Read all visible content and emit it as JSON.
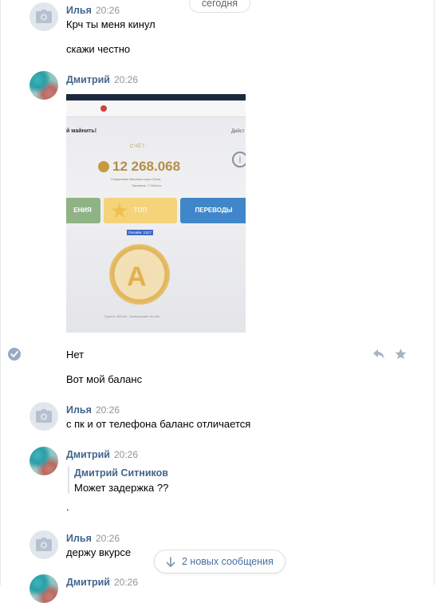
{
  "date_separator": "сегодня",
  "messages": [
    {
      "author": "Илья",
      "time": "20:26",
      "avatar": "camera-placeholder-icon",
      "lines": [
        "Крч ты меня кинул",
        "скажи честно"
      ]
    },
    {
      "author": "Дмитрий",
      "time": "20:26",
      "avatar": "photo",
      "attachment": {
        "kind": "photo",
        "screen_title": "й майнить!",
        "screen_action": "Дейст",
        "score_label": "СЧЁТ:",
        "score_value": "12 268.068",
        "sub1": "Сохранение баланса через 22сек.",
        "sub2": "Пассивно: 7.164/сек",
        "button_1": "ЕНИЯ",
        "button_2": "ТОП",
        "button_3": "ПЕРЕВОДЫ",
        "online": "Онлайн: 1317",
        "coin_letter": "A",
        "footer": "Группа: 4ВCoin · somtopvnabe.vk.com"
      },
      "lines": [
        "Нет",
        "Вот мой баланс"
      ],
      "read_icon": "check-circle-icon",
      "actions": [
        "reply-icon",
        "star-icon"
      ]
    },
    {
      "author": "Илья",
      "time": "20:26",
      "avatar": "camera-placeholder-icon",
      "lines": [
        "с пк и от телефона баланс отличается"
      ]
    },
    {
      "author": "Дмитрий",
      "time": "20:26",
      "avatar": "photo",
      "quote": {
        "author": "Дмитрий Ситников",
        "text": "Может задержка ??"
      },
      "lines": [
        "."
      ]
    },
    {
      "author": "Илья",
      "time": "20:26",
      "avatar": "camera-placeholder-icon",
      "lines": [
        "держу вкурсе"
      ]
    },
    {
      "author": "Дмитрий",
      "time": "20:26",
      "avatar": "photo"
    }
  ],
  "new_messages_button": "2 новых сообщения",
  "colors": {
    "author": "#42648b",
    "time": "#939393",
    "link": "#4a6ea1",
    "avatar_placeholder": "#e1e6ec"
  }
}
